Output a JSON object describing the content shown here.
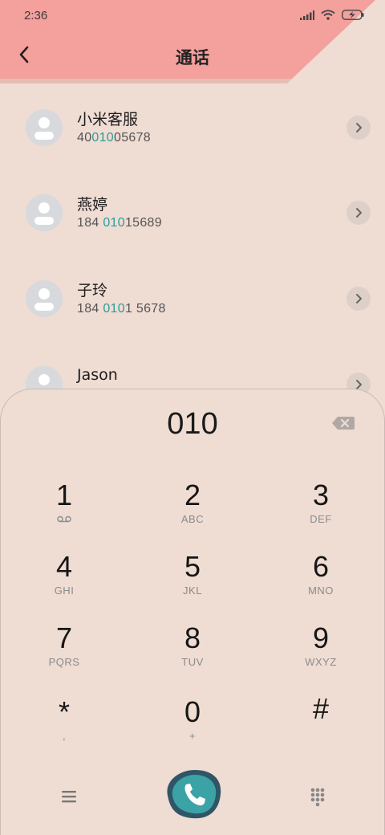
{
  "status_bar": {
    "time": "2:36",
    "icons": [
      "signal-icon",
      "wifi-icon",
      "battery-charging-icon"
    ]
  },
  "header": {
    "title": "通话",
    "back_icon": "back-arrow-icon",
    "accent_color": "#f4a09d"
  },
  "contacts": [
    {
      "name": "小米客服",
      "number_pre": "40",
      "number_match": "010",
      "number_post": "05678"
    },
    {
      "name": "燕婷",
      "number_pre": "184 ",
      "number_match": "010",
      "number_post": "15689"
    },
    {
      "name": "子玲",
      "number_pre": "184 ",
      "number_match": "010",
      "number_post": "1 5678"
    },
    {
      "name": "Jason",
      "number_pre": "",
      "number_match": "",
      "number_post": ""
    }
  ],
  "dialpad": {
    "input": "010",
    "keys": [
      {
        "digit": "1",
        "letters": "voicemail"
      },
      {
        "digit": "2",
        "letters": "ABC"
      },
      {
        "digit": "3",
        "letters": "DEF"
      },
      {
        "digit": "4",
        "letters": "GHI"
      },
      {
        "digit": "5",
        "letters": "JKL"
      },
      {
        "digit": "6",
        "letters": "MNO"
      },
      {
        "digit": "7",
        "letters": "PQRS"
      },
      {
        "digit": "8",
        "letters": "TUV"
      },
      {
        "digit": "9",
        "letters": "WXYZ"
      },
      {
        "digit": "*",
        "letters": ","
      },
      {
        "digit": "0",
        "letters": "+"
      },
      {
        "digit": "#",
        "letters": ""
      }
    ]
  },
  "colors": {
    "background": "#efdcd3",
    "highlight": "#2a9d9a",
    "call_button": "#3a8f94"
  }
}
